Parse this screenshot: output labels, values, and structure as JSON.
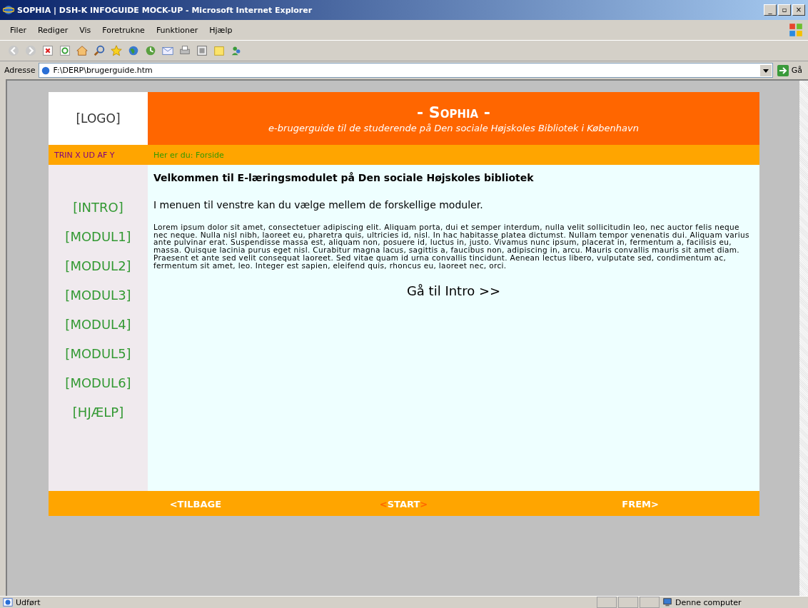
{
  "window": {
    "title": "SOPHIA | DSH-K INFOGUIDE MOCK-UP - Microsoft Internet Explorer",
    "controls": [
      "_",
      "▫",
      "×"
    ]
  },
  "menu": [
    "Filer",
    "Rediger",
    "Vis",
    "Foretrukne",
    "Funktioner",
    "Hjælp"
  ],
  "address": {
    "label": "Adresse",
    "value": "F:\\DERP\\brugerguide.htm",
    "go": "Gå"
  },
  "page": {
    "logo": "[LOGO]",
    "title": "- Sophia -",
    "subtitle": "e-brugerguide til de studerende på Den sociale Højskoles Bibliotek i København",
    "step": "TRIN X UD AF Y",
    "breadcrumb": "Her er du: Forside",
    "nav": [
      {
        "label": "[INTRO]"
      },
      {
        "label": "[MODUL1]"
      },
      {
        "label": "[MODUL2]"
      },
      {
        "label": "[MODUL3]"
      },
      {
        "label": "[MODUL4]"
      },
      {
        "label": "[MODUL5]"
      },
      {
        "label": "[MODUL6]"
      },
      {
        "label": "[HJÆLP]"
      }
    ],
    "heading": "Velkommen til E-læringsmodulet på Den sociale Højskoles bibliotek",
    "intro": "I menuen til venstre kan du vælge mellem de forskellige moduler.",
    "body": "Lorem ipsum dolor sit amet, consectetuer adipiscing elit. Aliquam porta, dui et semper interdum, nulla velit sollicitudin leo, nec auctor felis neque nec neque. Nulla nisl nibh, laoreet eu, pharetra quis, ultricies id, nisl. In hac habitasse platea dictumst. Nullam tempor venenatis dui. Aliquam varius ante pulvinar erat. Suspendisse massa est, aliquam non, posuere id, luctus in, justo. Vivamus nunc ipsum, placerat in, fermentum a, facilisis eu, massa. Quisque lacinia purus eget nisl. Curabitur magna lacus, sagittis a, faucibus non, adipiscing in, arcu. Mauris convallis mauris sit amet diam. Praesent et ante sed velit consequat laoreet. Sed vitae quam id urna convallis tincidunt. Aenean lectus libero, vulputate sed, condimentum ac, fermentum sit amet, leo. Integer est sapien, eleifend quis, rhoncus eu, laoreet nec, orci.",
    "cta": "Gå til Intro >>",
    "footer": [
      {
        "label": "<TILBAGE"
      },
      {
        "prefix": "<",
        "label": "START",
        "suffix": ">"
      },
      {
        "label": "FREM>"
      }
    ]
  },
  "status_bar": {
    "text": "Udført",
    "zone": "Denne computer"
  }
}
